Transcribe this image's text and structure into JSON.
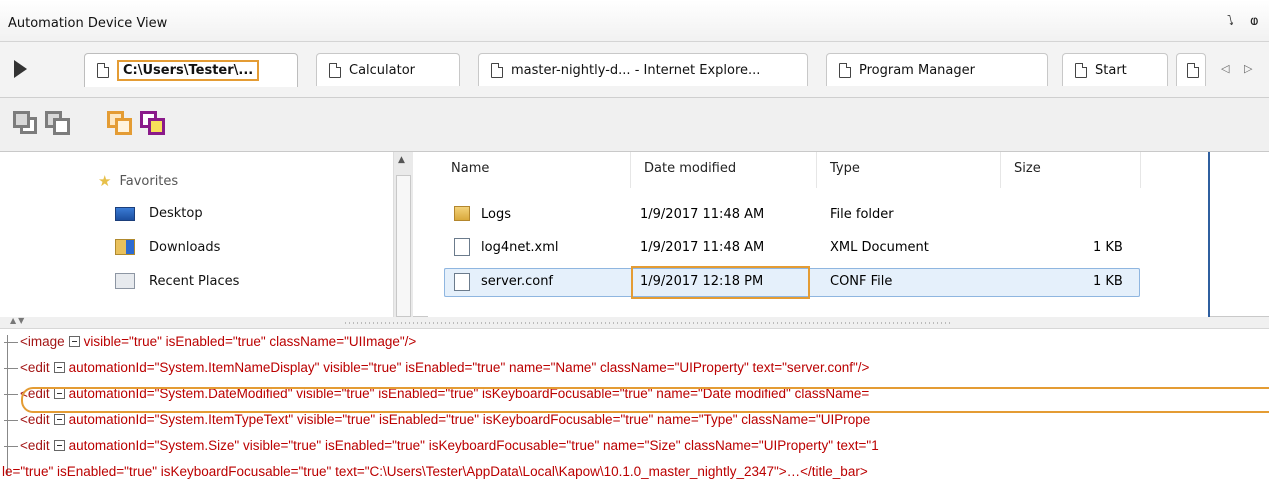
{
  "window": {
    "title": "Automation Device View",
    "restore_glyph": "⭝",
    "pin_glyph": "ⱷ"
  },
  "tabs": [
    {
      "label": "C:\\Users\\Tester\\...",
      "active": true
    },
    {
      "label": "Calculator",
      "active": false
    },
    {
      "label": "master-nightly-d... - Internet Explore...",
      "active": false
    },
    {
      "label": "Program Manager",
      "active": false
    },
    {
      "label": "Start",
      "active": false
    }
  ],
  "tab_nav": {
    "prev": "◁",
    "next": "▷"
  },
  "toolbar": {
    "buttons": [
      {
        "name": "gray-window-back-icon",
        "color": "#7c7c7c"
      },
      {
        "name": "gray-window-front-icon",
        "color": "#7c7c7c"
      },
      {
        "name": "orange-window-refresh-icon",
        "color": "#e49c34"
      },
      {
        "name": "purple-window-star-icon",
        "color": "#8a1a8a"
      }
    ]
  },
  "explorer": {
    "nav": {
      "favorites_label": "Favorites",
      "items": [
        {
          "label": "Desktop",
          "icon": "desktop-icon"
        },
        {
          "label": "Downloads",
          "icon": "downloads-icon"
        },
        {
          "label": "Recent Places",
          "icon": "recent-places-icon"
        }
      ]
    },
    "columns": {
      "name": "Name",
      "date": "Date modified",
      "type": "Type",
      "size": "Size"
    },
    "rows": [
      {
        "name": "Logs",
        "date": "1/9/2017 11:48 AM",
        "type": "File folder",
        "size": "",
        "icon": "folder-icon",
        "selected": false
      },
      {
        "name": "log4net.xml",
        "date": "1/9/2017 11:48 AM",
        "type": "XML Document",
        "size": "1 KB",
        "icon": "xml-file-icon",
        "selected": false
      },
      {
        "name": "server.conf",
        "date": "1/9/2017 12:18 PM",
        "type": "CONF File",
        "size": "1 KB",
        "icon": "conf-file-icon",
        "selected": true
      }
    ]
  },
  "tree": {
    "lines": [
      {
        "tag": "<image",
        "attrs": "visible=\"true\" isEnabled=\"true\" className=\"UIImage\"/>"
      },
      {
        "tag": "<edit",
        "attrs": "automationId=\"System.ItemNameDisplay\" visible=\"true\" isEnabled=\"true\" name=\"Name\" className=\"UIProperty\" text=\"server.conf\"/>"
      },
      {
        "tag": "<edit",
        "attrs": "automationId=\"System.DateModified\" visible=\"true\" isEnabled=\"true\" isKeyboardFocusable=\"true\" name=\"Date modified\" className="
      },
      {
        "tag": "<edit",
        "attrs": "automationId=\"System.ItemTypeText\" visible=\"true\" isEnabled=\"true\" isKeyboardFocusable=\"true\" name=\"Type\" className=\"UIPrope"
      },
      {
        "tag": "<edit",
        "attrs": "automationId=\"System.Size\" visible=\"true\" isEnabled=\"true\" isKeyboardFocusable=\"true\" name=\"Size\" className=\"UIProperty\" text=\"1"
      }
    ],
    "last_line": "le=\"true\" isEnabled=\"true\" isKeyboardFocusable=\"true\" text=\"C:\\Users\\Tester\\AppData\\Local\\Kapow\\10.1.0_master_nightly_2347\">…</title_bar>"
  }
}
